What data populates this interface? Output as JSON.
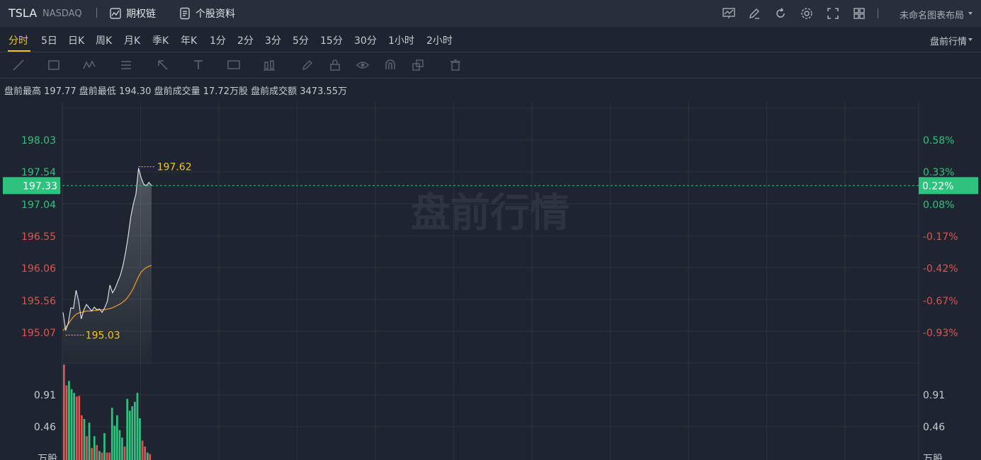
{
  "header": {
    "symbol": "TSLA",
    "exchange": "NASDAQ",
    "options_chain_label": "期权链",
    "profile_label": "个股资料",
    "layout_name": "未命名图表布局",
    "icons": [
      "chart-icon",
      "edit-icon",
      "refresh-icon",
      "settings-icon",
      "fullscreen-icon",
      "layout-grid-icon"
    ]
  },
  "periods": {
    "items": [
      "分时",
      "5日",
      "日K",
      "周K",
      "月K",
      "季K",
      "年K",
      "1分",
      "2分",
      "3分",
      "5分",
      "15分",
      "30分",
      "1小时",
      "2小时"
    ],
    "active": "分时"
  },
  "session_label": "盘前行情",
  "tools": [
    "trendline-tool-icon",
    "rectangle-tool-icon",
    "pattern-tool-icon",
    "fib-tool-icon",
    "arrow-tool-icon",
    "text-tool-icon",
    "note-tool-icon",
    "candle-tool-icon",
    "pencil-icon",
    "lock-icon",
    "eye-icon",
    "magnet-icon",
    "duplicate-icon",
    "trash-icon"
  ],
  "stats": {
    "high_label": "盘前最高",
    "high": "197.77",
    "low_label": "盘前最低",
    "low": "194.30",
    "volume_label": "盘前成交量",
    "volume": "17.72万股",
    "amount_label": "盘前成交额",
    "amount": "3473.55万"
  },
  "colors": {
    "up": "#2ec27e",
    "down": "#e05353",
    "accent": "#f5c518",
    "price_line": "#e6e9ee",
    "avg_line": "#f59a23"
  },
  "chart_data": {
    "type": "line",
    "watermark": "盘前行情",
    "current_price": "197.33",
    "current_pct": "0.22%",
    "price_ticks": [
      {
        "price": "198.03",
        "pct": "0.58%",
        "dir": "up"
      },
      {
        "price": "197.54",
        "pct": "0.33%",
        "dir": "up"
      },
      {
        "price": "197.04",
        "pct": "0.08%",
        "dir": "up"
      },
      {
        "price": "196.55",
        "pct": "-0.17%",
        "dir": "down"
      },
      {
        "price": "196.06",
        "pct": "-0.42%",
        "dir": "down"
      },
      {
        "price": "195.56",
        "pct": "-0.67%",
        "dir": "down"
      },
      {
        "price": "195.07",
        "pct": "-0.93%",
        "dir": "down"
      }
    ],
    "ylim": [
      194.7,
      198.2
    ],
    "max_label": "197.62",
    "min_label": "195.03",
    "price_series": [
      195.38,
      195.1,
      195.22,
      195.45,
      195.44,
      195.72,
      195.55,
      195.28,
      195.42,
      195.5,
      195.45,
      195.4,
      195.46,
      195.42,
      195.43,
      195.38,
      195.45,
      195.55,
      195.8,
      195.68,
      195.75,
      195.85,
      195.95,
      196.1,
      196.3,
      196.55,
      196.85,
      197.05,
      197.2,
      197.6,
      197.45,
      197.35,
      197.33,
      197.38,
      197.33
    ],
    "avg_series": [
      195.1,
      195.15,
      195.2,
      195.26,
      195.31,
      195.35,
      195.37,
      195.38,
      195.39,
      195.4,
      195.4,
      195.4,
      195.41,
      195.41,
      195.42,
      195.42,
      195.42,
      195.43,
      195.44,
      195.45,
      195.47,
      195.49,
      195.51,
      195.54,
      195.57,
      195.62,
      195.68,
      195.75,
      195.84,
      195.93,
      196.0,
      196.04,
      196.07,
      196.09,
      196.1
    ],
    "volume_ticks": [
      "0.91",
      "0.46"
    ],
    "volume_unit": "万股",
    "vol_ylim": [
      0,
      1.3
    ],
    "volumes": [
      1.28,
      1.0,
      1.06,
      0.95,
      0.9,
      0.85,
      0.86,
      0.6,
      0.55,
      0.32,
      0.5,
      0.16,
      0.32,
      0.2,
      0.12,
      0.1,
      0.36,
      0.1,
      0.1,
      0.7,
      0.46,
      0.6,
      0.4,
      0.3,
      0.18,
      0.82,
      0.66,
      0.72,
      0.78,
      0.9,
      0.56,
      0.26,
      0.18,
      0.1,
      0.08
    ],
    "volume_dirs": [
      "down",
      "down",
      "up",
      "up",
      "up",
      "down",
      "down",
      "down",
      "up",
      "down",
      "up",
      "down",
      "up",
      "down",
      "up",
      "down",
      "up",
      "down",
      "down",
      "up",
      "up",
      "up",
      "up",
      "up",
      "down",
      "up",
      "up",
      "up",
      "up",
      "up",
      "up",
      "down",
      "down",
      "up",
      "down"
    ]
  }
}
